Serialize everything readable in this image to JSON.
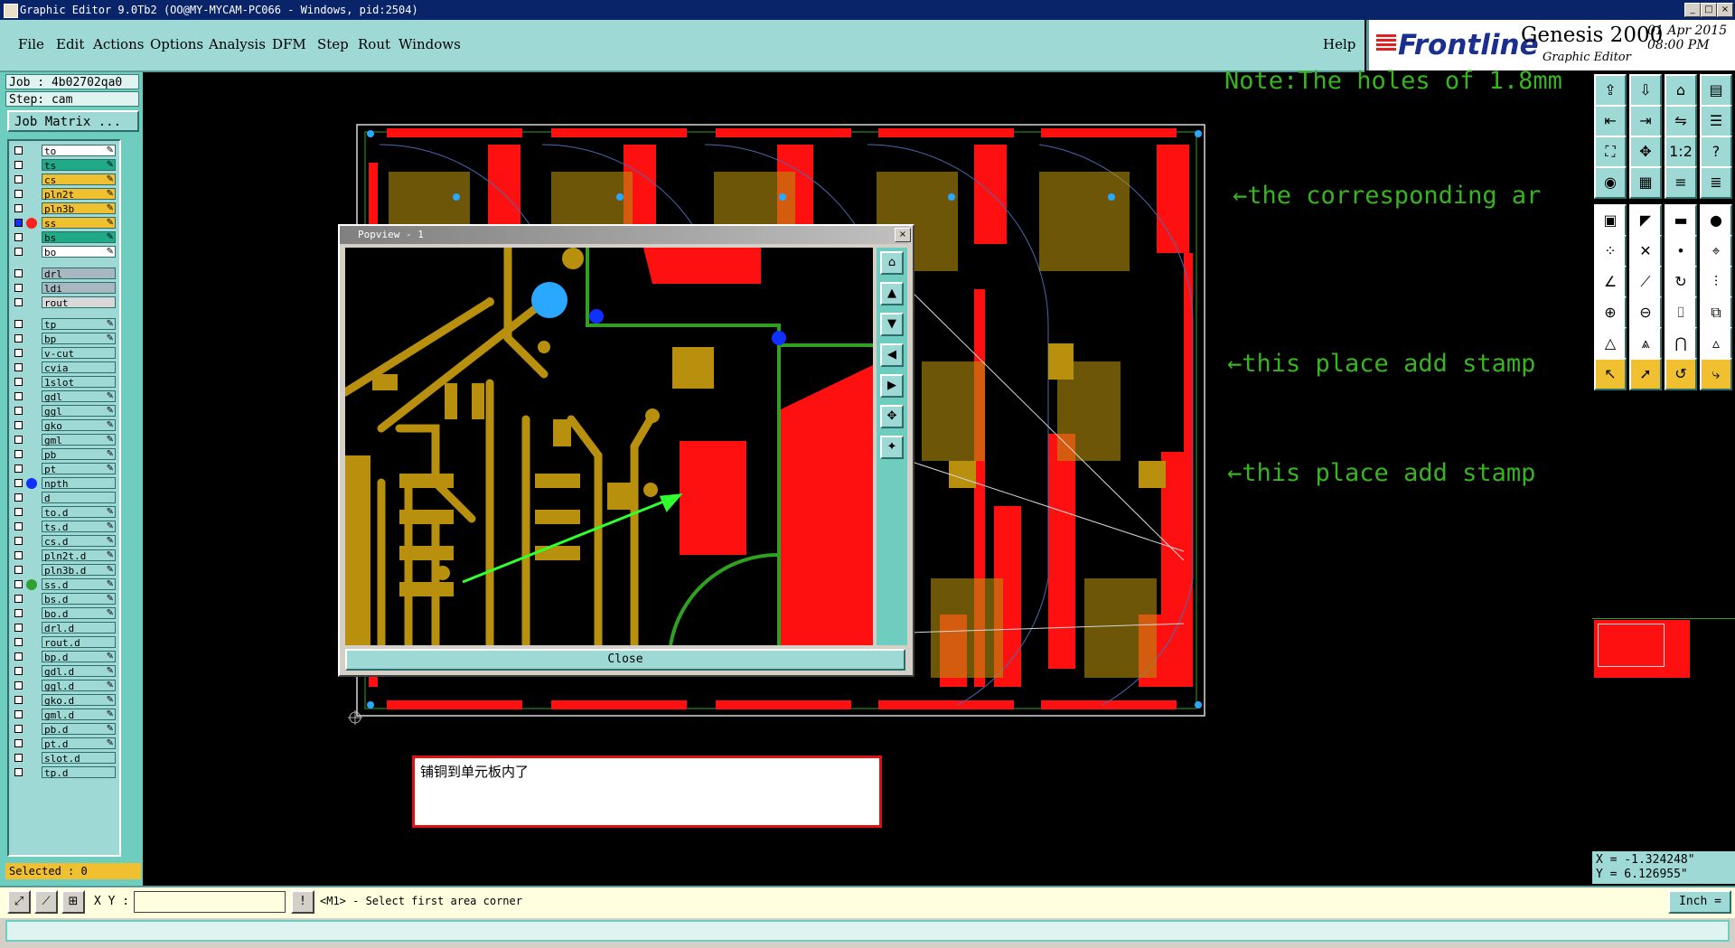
{
  "window": {
    "title": "Graphic Editor 9.0Tb2 (OO@MY-MYCAM-PC066 - Windows, pid:2504)"
  },
  "menu": {
    "items": [
      "File",
      "Edit",
      "Actions",
      "Options",
      "Analysis",
      "DFM",
      "Step",
      "Rout",
      "Windows"
    ],
    "help": "Help"
  },
  "brand": {
    "logo": "Frontline",
    "product": "Genesis 2000",
    "subtitle": "Graphic Editor",
    "datetime": "01 Apr 2015\n08:00 PM"
  },
  "job": {
    "job": "Job : 4b02702qa0",
    "step": "Step: cam",
    "matrix_button": "Job Matrix ..."
  },
  "layers": [
    {
      "name": "to",
      "color": "#ffffff",
      "pen": "✎"
    },
    {
      "name": "ts",
      "color": "#1faa88",
      "pen": "✎"
    },
    {
      "name": "cs",
      "color": "#f0c030",
      "pen": "✎"
    },
    {
      "name": "pln2t",
      "color": "#f0c030",
      "pen": "✎"
    },
    {
      "name": "pln3b",
      "color": "#f0c030",
      "pen": "✎"
    },
    {
      "name": "ss",
      "color": "#f0c030",
      "pen": "✎",
      "active": true,
      "dot": "#ff2020"
    },
    {
      "name": "bs",
      "color": "#1faa88",
      "pen": "✎"
    },
    {
      "name": "bo",
      "color": "#ffffff",
      "pen": "✎"
    },
    {
      "gap": true
    },
    {
      "name": "drl",
      "color": "#a8b8c0",
      "pen": ""
    },
    {
      "name": "ldi",
      "color": "#a8b8c0",
      "pen": ""
    },
    {
      "name": "rout",
      "color": "#d8d8d8",
      "pen": ""
    },
    {
      "gap": true
    },
    {
      "name": "tp",
      "color": "#9fd9d6",
      "pen": "✎"
    },
    {
      "name": "bp",
      "color": "#9fd9d6",
      "pen": "✎"
    },
    {
      "name": "v-cut",
      "color": "#9fd9d6",
      "pen": ""
    },
    {
      "name": "cvia",
      "color": "#9fd9d6",
      "pen": ""
    },
    {
      "name": "1slot",
      "color": "#9fd9d6",
      "pen": ""
    },
    {
      "name": "gdl",
      "color": "#9fd9d6",
      "pen": "✎"
    },
    {
      "name": "ggl",
      "color": "#9fd9d6",
      "pen": "✎"
    },
    {
      "name": "gko",
      "color": "#9fd9d6",
      "pen": "✎"
    },
    {
      "name": "gml",
      "color": "#9fd9d6",
      "pen": "✎"
    },
    {
      "name": "pb",
      "color": "#9fd9d6",
      "pen": "✎"
    },
    {
      "name": "pt",
      "color": "#9fd9d6",
      "pen": "✎"
    },
    {
      "name": "npth",
      "color": "#9fd9d6",
      "pen": "",
      "dot": "#1030ff"
    },
    {
      "name": "d",
      "color": "#9fd9d6",
      "pen": ""
    },
    {
      "name": "to.d",
      "color": "#9fd9d6",
      "pen": "✎"
    },
    {
      "name": "ts.d",
      "color": "#9fd9d6",
      "pen": "✎"
    },
    {
      "name": "cs.d",
      "color": "#9fd9d6",
      "pen": "✎"
    },
    {
      "name": "pln2t.d",
      "color": "#9fd9d6",
      "pen": "✎"
    },
    {
      "name": "pln3b.d",
      "color": "#9fd9d6",
      "pen": "✎"
    },
    {
      "name": "ss.d",
      "color": "#9fd9d6",
      "pen": "✎",
      "dot": "#30a030"
    },
    {
      "name": "bs.d",
      "color": "#9fd9d6",
      "pen": "✎"
    },
    {
      "name": "bo.d",
      "color": "#9fd9d6",
      "pen": "✎"
    },
    {
      "name": "drl.d",
      "color": "#9fd9d6",
      "pen": ""
    },
    {
      "name": "rout.d",
      "color": "#9fd9d6",
      "pen": ""
    },
    {
      "name": "bp.d",
      "color": "#9fd9d6",
      "pen": "✎"
    },
    {
      "name": "gdl.d",
      "color": "#9fd9d6",
      "pen": "✎"
    },
    {
      "name": "ggl.d",
      "color": "#9fd9d6",
      "pen": "✎"
    },
    {
      "name": "gko.d",
      "color": "#9fd9d6",
      "pen": "✎"
    },
    {
      "name": "gml.d",
      "color": "#9fd9d6",
      "pen": "✎"
    },
    {
      "name": "pb.d",
      "color": "#9fd9d6",
      "pen": "✎"
    },
    {
      "name": "pt.d",
      "color": "#9fd9d6",
      "pen": "✎"
    },
    {
      "name": "slot.d",
      "color": "#9fd9d6",
      "pen": ""
    },
    {
      "name": "tp.d",
      "color": "#9fd9d6",
      "pen": ""
    }
  ],
  "selected": "Selected : 0",
  "annotations": {
    "note": "Note:The holes of 1.8mm",
    "corresponding": "←the corresponding ar",
    "stamp1": "←this place add stamp",
    "stamp2": "←this place add stamp"
  },
  "popview": {
    "title": "Popview - 1",
    "close_button": "Close"
  },
  "message": "铺铜到单元板内了",
  "coords": {
    "x": "X = -1.324248\"",
    "y": "Y = 6.126955\""
  },
  "bottom": {
    "xy_label": "X Y :",
    "xy_value": "",
    "prompt": "<M1> - Select first area corner",
    "units": "Inch ="
  },
  "colors": {
    "copper": "#b8900e",
    "pad_red": "#ff1010",
    "trace_green": "#2fa020",
    "via_blue": "#2aa8ff",
    "panel_bg": "#6ecdbf"
  }
}
